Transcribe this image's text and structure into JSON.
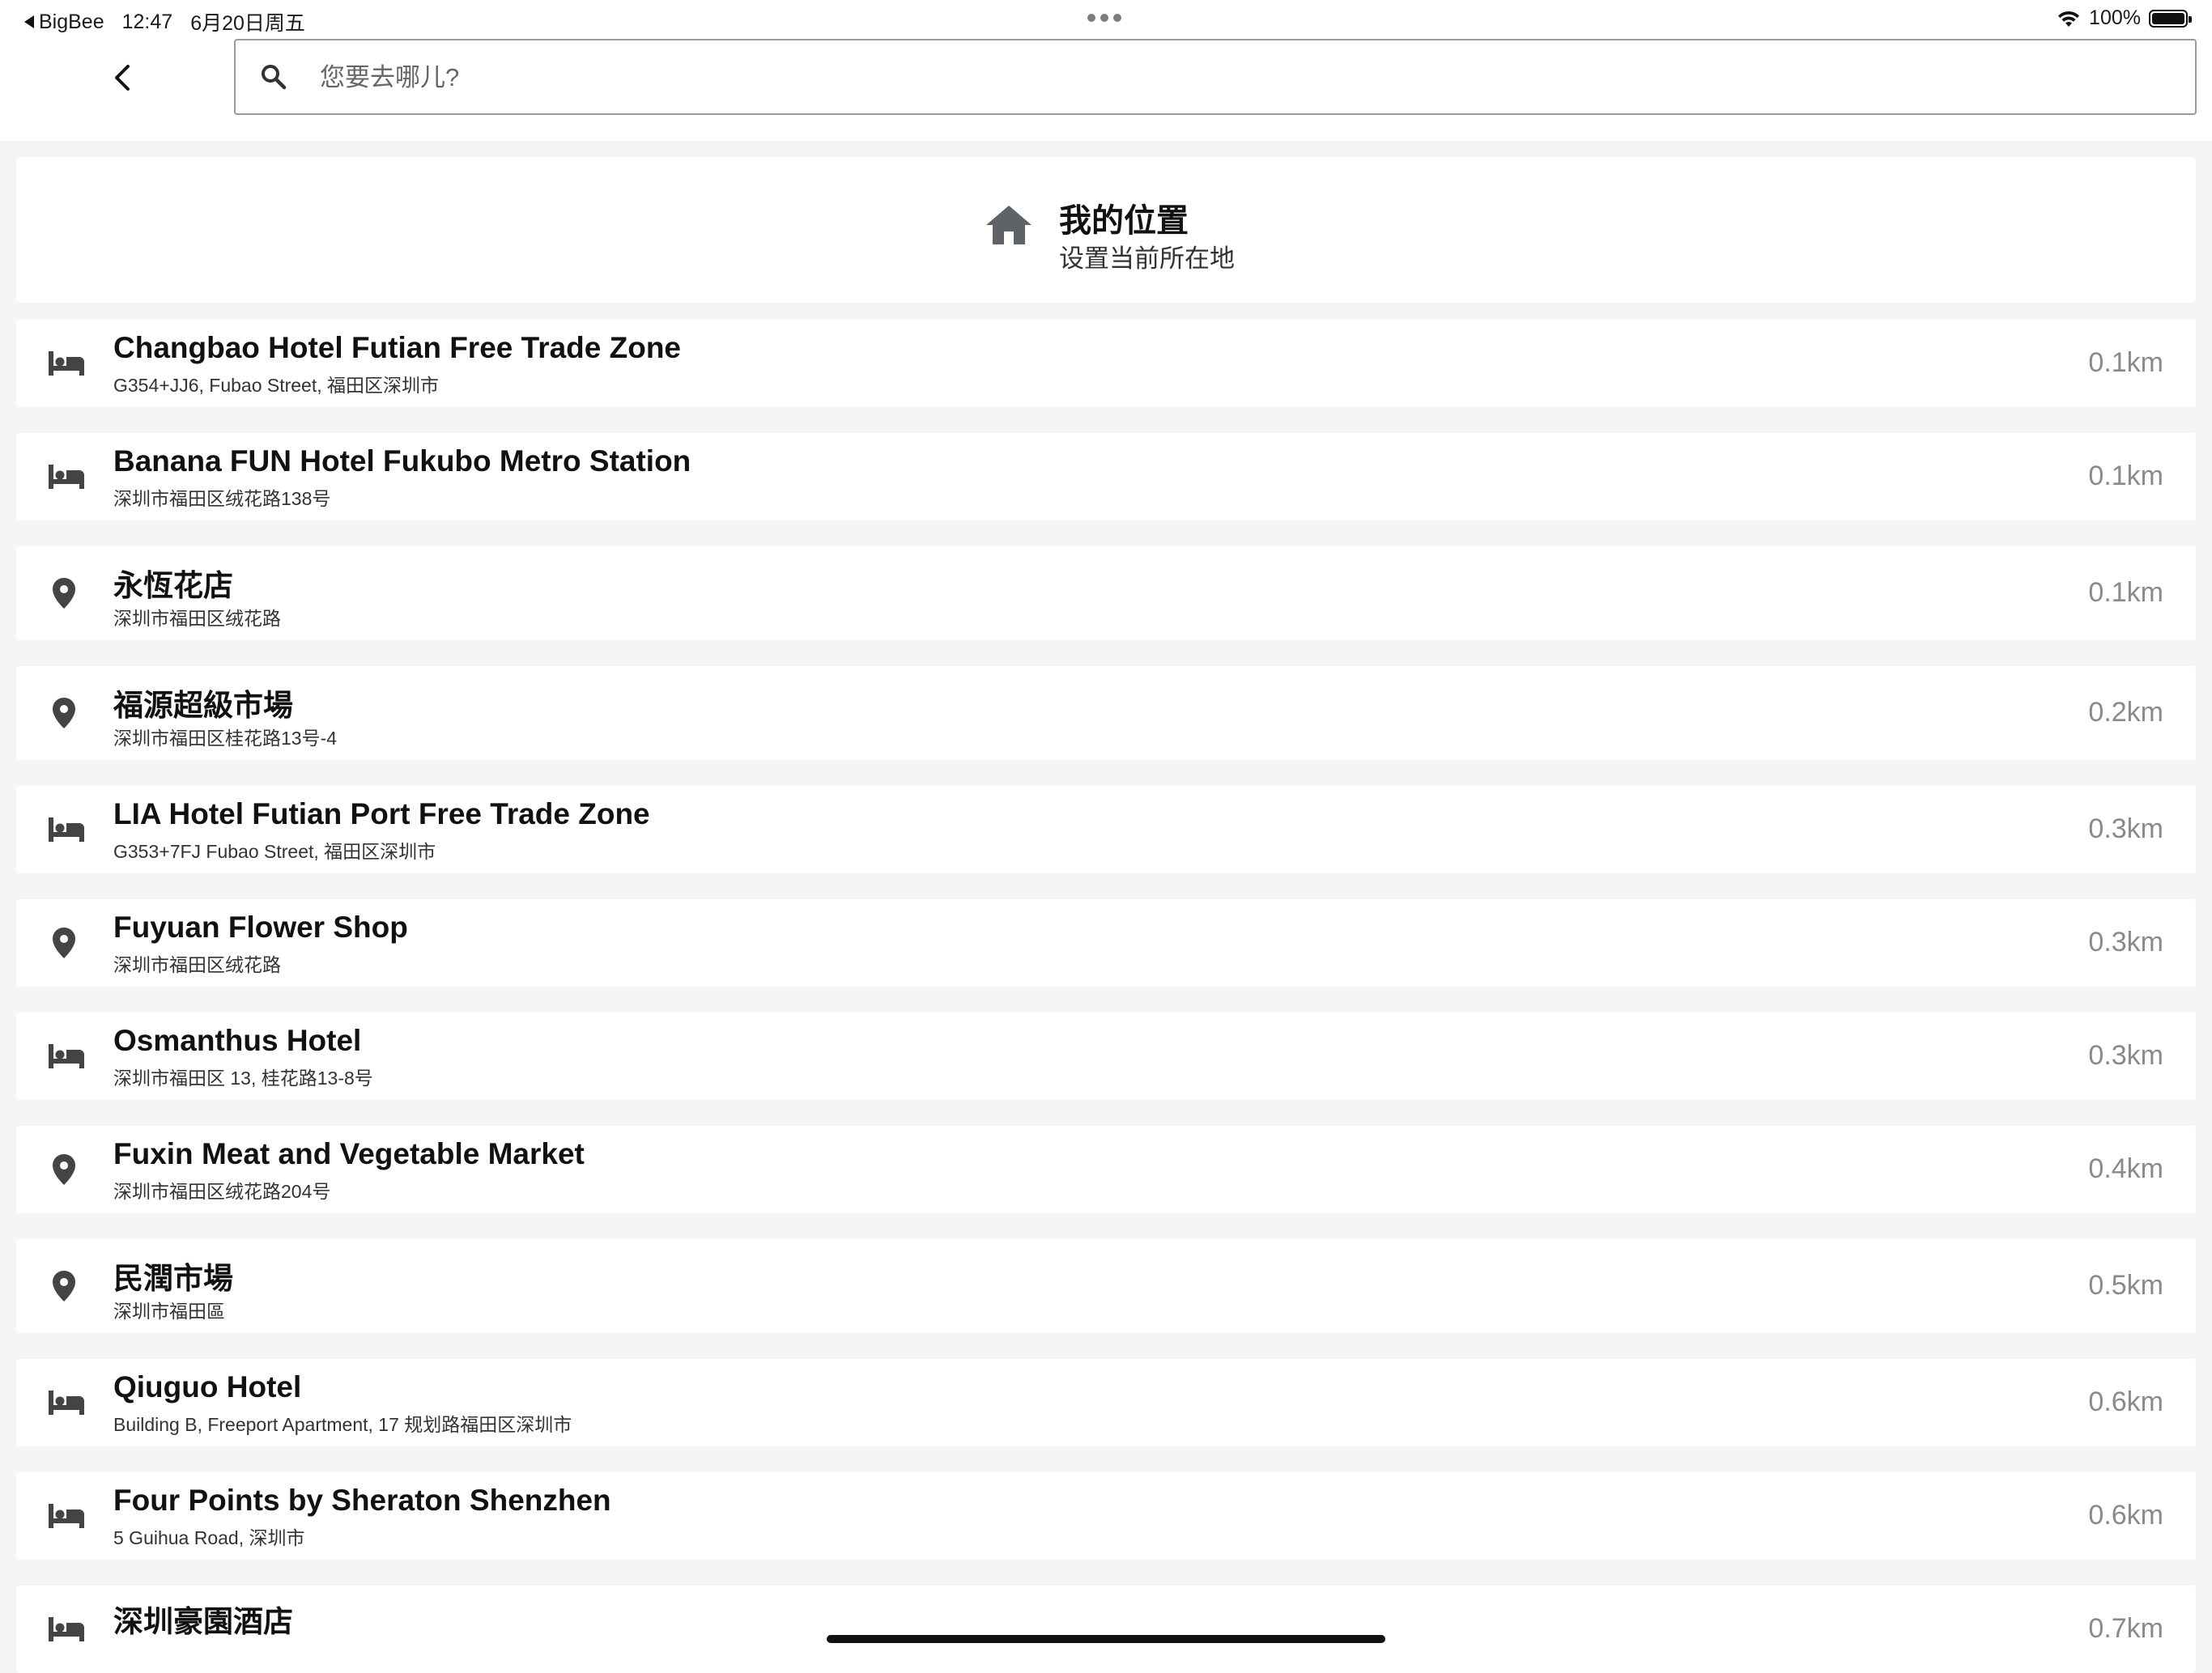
{
  "status_bar": {
    "back_app": "BigBee",
    "time": "12:47",
    "date": "6月20日周五",
    "battery": "100%"
  },
  "search": {
    "placeholder": "您要去哪儿?",
    "value": ""
  },
  "my_location": {
    "title": "我的位置",
    "subtitle": "设置当前所在地",
    "icon": "home-icon"
  },
  "places": [
    {
      "type": "hotel",
      "icon": "bed-icon",
      "name": "Changbao Hotel Futian Free Trade Zone",
      "address": "G354+JJ6, Fubao Street, 福田区深圳市",
      "distance": "0.1km"
    },
    {
      "type": "hotel",
      "icon": "bed-icon",
      "name": "Banana FUN Hotel Fukubo Metro Station",
      "address": "深圳市福田区绒花路138号",
      "distance": "0.1km"
    },
    {
      "type": "place",
      "icon": "location-pin-icon",
      "name": "永恆花店",
      "address": "深圳市福田区绒花路",
      "distance": "0.1km"
    },
    {
      "type": "place",
      "icon": "location-pin-icon",
      "name": "福源超級市場",
      "address": "深圳市福田区桂花路13号-4",
      "distance": "0.2km"
    },
    {
      "type": "hotel",
      "icon": "bed-icon",
      "name": "LIA Hotel Futian Port Free Trade Zone",
      "address": "G353+7FJ Fubao Street, 福田区深圳市",
      "distance": "0.3km"
    },
    {
      "type": "place",
      "icon": "location-pin-icon",
      "name": "Fuyuan Flower Shop",
      "address": "深圳市福田区绒花路",
      "distance": "0.3km"
    },
    {
      "type": "hotel",
      "icon": "bed-icon",
      "name": "Osmanthus Hotel",
      "address": "深圳市福田区 13, 桂花路13-8号",
      "distance": "0.3km"
    },
    {
      "type": "place",
      "icon": "location-pin-icon",
      "name": "Fuxin Meat and Vegetable Market",
      "address": "深圳市福田区绒花路204号",
      "distance": "0.4km"
    },
    {
      "type": "place",
      "icon": "location-pin-icon",
      "name": "民潤市場",
      "address": "深圳市福田區",
      "distance": "0.5km"
    },
    {
      "type": "hotel",
      "icon": "bed-icon",
      "name": "Qiuguo Hotel",
      "address": "Building B, Freeport Apartment, 17 规划路福田区深圳市",
      "distance": "0.6km"
    },
    {
      "type": "hotel",
      "icon": "bed-icon",
      "name": "Four Points by Sheraton Shenzhen",
      "address": "5 Guihua Road, 深圳市",
      "distance": "0.6km"
    },
    {
      "type": "hotel",
      "icon": "bed-icon",
      "name": "深圳豪園酒店",
      "address": "",
      "distance": "0.7km"
    }
  ]
}
